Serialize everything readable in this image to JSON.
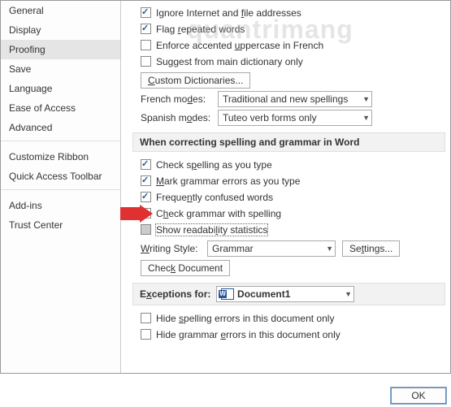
{
  "sidebar": {
    "items": [
      {
        "label": "General"
      },
      {
        "label": "Display"
      },
      {
        "label": "Proofing"
      },
      {
        "label": "Save"
      },
      {
        "label": "Language"
      },
      {
        "label": "Ease of Access"
      },
      {
        "label": "Advanced"
      },
      {
        "label": "Customize Ribbon"
      },
      {
        "label": "Quick Access Toolbar"
      },
      {
        "label": "Add-ins"
      },
      {
        "label": "Trust Center"
      }
    ],
    "selected_index": 2
  },
  "top_checks": {
    "ignore_internet": "Ignore Internet and file addresses",
    "flag_repeated": "Flag repeated words",
    "enforce_accented": "Enforce accented uppercase in French",
    "suggest_main": "Suggest from main dictionary only"
  },
  "buttons": {
    "custom_dict": "Custom Dictionaries...",
    "settings": "Settings...",
    "check_doc": "Check Document",
    "ok": "OK"
  },
  "modes": {
    "french_label": "French modes:",
    "french_value": "Traditional and new spellings",
    "spanish_label": "Spanish modes:",
    "spanish_value": "Tuteo verb forms only"
  },
  "section2": {
    "header": "When correcting spelling and grammar in Word",
    "check_spelling": "Check spelling as you type",
    "mark_grammar": "Mark grammar errors as you type",
    "freq_confused": "Frequently confused words",
    "grammar_spelling": "Check grammar with spelling",
    "readability": "Show readability statistics",
    "writing_style_label": "Writing Style:",
    "writing_style_value": "Grammar"
  },
  "section3": {
    "header_label": "Exceptions for:",
    "doc_value": "Document1",
    "hide_spelling": "Hide spelling errors in this document only",
    "hide_grammar": "Hide grammar errors in this document only"
  },
  "watermark": "quantrimang"
}
